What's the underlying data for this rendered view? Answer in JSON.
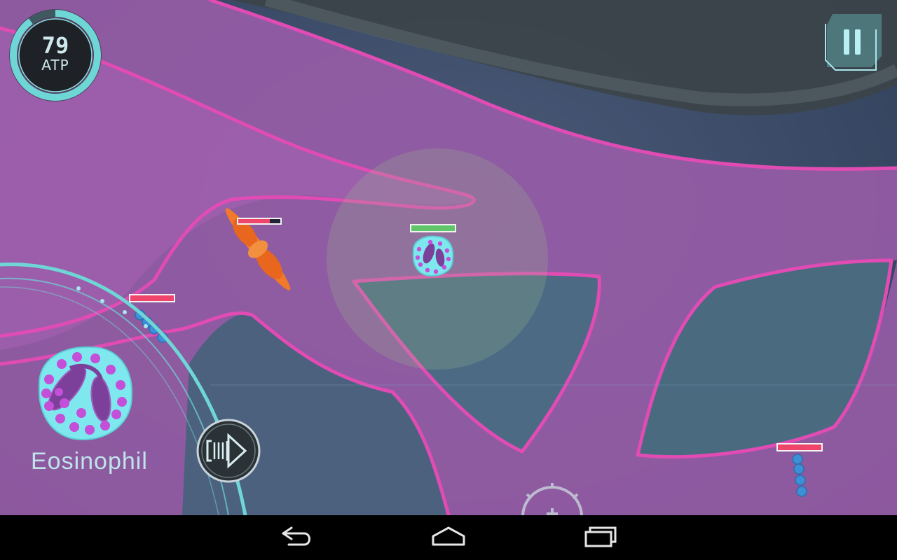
{
  "hud": {
    "atp": {
      "value": "79",
      "label": "ATP",
      "fill_fraction": 0.9
    },
    "pause": {
      "icon": "pause-icon"
    }
  },
  "unit_selector": {
    "selected_unit": "Eosinophil",
    "unit_icon": "eosinophil-cell-icon",
    "next_button_icon": "next-arrow-icon"
  },
  "entities": {
    "player_cell": {
      "type": "eosinophil",
      "health_fraction": 1.0,
      "health_color": "#5fc66a"
    },
    "orange_bacterium": {
      "type": "orange-rod-bacterium",
      "health_fraction": 0.75,
      "health_color": "#f0456a"
    },
    "blue_chain_left": {
      "type": "blue-chain-bacterium",
      "health_fraction": 1.0,
      "health_color": "#f0456a"
    },
    "blue_chain_right": {
      "type": "blue-chain-bacterium",
      "health_fraction": 1.0,
      "health_color": "#f0456a"
    }
  },
  "colors": {
    "tissue_fill": "#9a5ca8",
    "tissue_edge": "#e04cb4",
    "hud_accent": "#6fd6d6",
    "granule": "#c44fd8"
  },
  "system_nav": {
    "back_icon": "back-icon",
    "home_icon": "home-icon",
    "recents_icon": "recents-icon"
  }
}
